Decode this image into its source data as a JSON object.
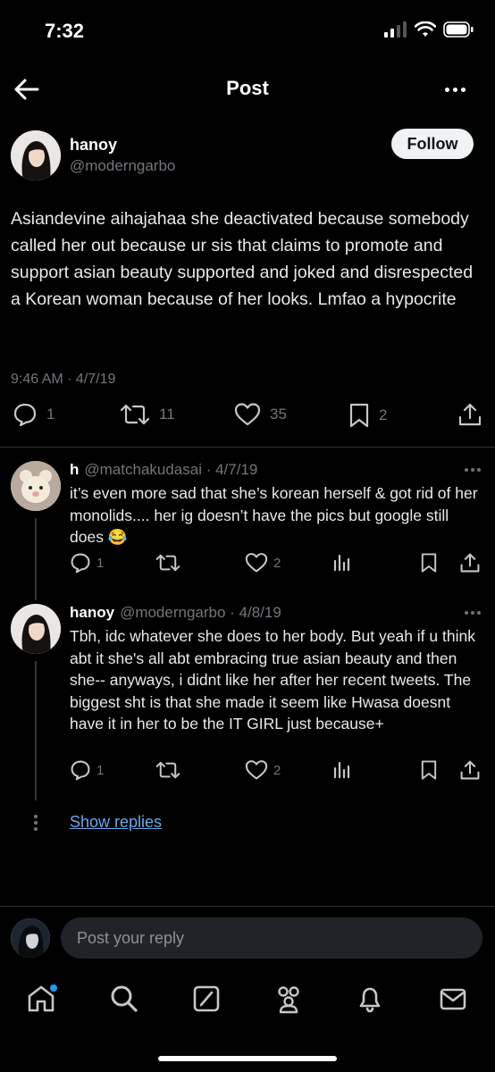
{
  "status_bar": {
    "time": "7:32"
  },
  "header": {
    "title": "Post"
  },
  "main_post": {
    "name": "hanoy",
    "handle": "@moderngarbo",
    "follow_label": "Follow",
    "text": "Asiandevine aihajahaa she deactivated because somebody called her out because ur sis that claims to promote and support asian beauty supported and joked and disrespected a Korean woman because of her looks. Lmfao a hypocrite",
    "timestamp": "9:46 AM · 4/7/19",
    "replies": "1",
    "reposts": "11",
    "likes": "35",
    "bookmarks": "2"
  },
  "replies": [
    {
      "name": "h",
      "handle": "@matchakudasai · 4/7/19",
      "text": "it’s even more sad that she’s korean herself & got rid of her monolids.... her ig doesn’t have the pics but google still does 😂",
      "replies": "1",
      "likes": "2"
    },
    {
      "name": "hanoy",
      "handle": "@moderngarbo · 4/8/19",
      "text": "Tbh, idc whatever she does to her body. But yeah if u think abt it she's all abt embracing true asian beauty and then she-- anyways, i didnt like her after her recent tweets. The biggest sht is that she made it seem like Hwasa doesnt have it in her to be the IT GIRL just because+",
      "replies": "1",
      "likes": "2"
    }
  ],
  "show_replies_label": "Show replies",
  "reply_bar": {
    "placeholder": "Post your reply"
  },
  "icons": {
    "back": "arrow-left-icon",
    "more": "more-horizontal-icon",
    "reply": "chat-bubble-icon",
    "repost": "repost-icon",
    "like": "heart-icon",
    "bookmark": "bookmark-icon",
    "share": "share-icon",
    "views": "bar-chart-icon",
    "tabs": [
      "home-icon",
      "search-icon",
      "grok-icon",
      "communities-icon",
      "bell-icon",
      "mail-icon"
    ]
  },
  "colors": {
    "background": "#000000",
    "accent": "#1d9bf0",
    "link": "#6aa8e8",
    "muted": "#71767b"
  }
}
